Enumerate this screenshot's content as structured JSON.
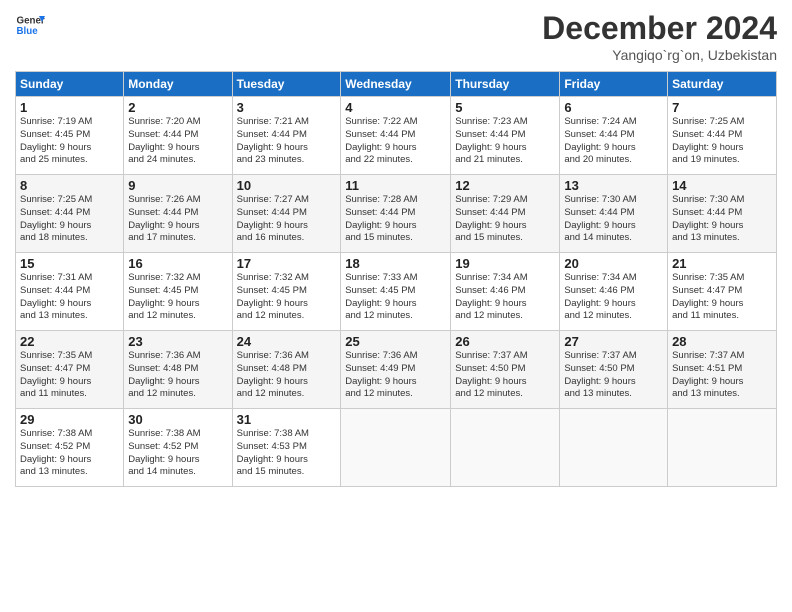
{
  "header": {
    "logo_line1": "General",
    "logo_line2": "Blue",
    "title": "December 2024",
    "subtitle": "Yangiqo`rg`on, Uzbekistan"
  },
  "weekdays": [
    "Sunday",
    "Monday",
    "Tuesday",
    "Wednesday",
    "Thursday",
    "Friday",
    "Saturday"
  ],
  "weeks": [
    [
      {
        "day": "1",
        "info": "Sunrise: 7:19 AM\nSunset: 4:45 PM\nDaylight: 9 hours\nand 25 minutes."
      },
      {
        "day": "2",
        "info": "Sunrise: 7:20 AM\nSunset: 4:44 PM\nDaylight: 9 hours\nand 24 minutes."
      },
      {
        "day": "3",
        "info": "Sunrise: 7:21 AM\nSunset: 4:44 PM\nDaylight: 9 hours\nand 23 minutes."
      },
      {
        "day": "4",
        "info": "Sunrise: 7:22 AM\nSunset: 4:44 PM\nDaylight: 9 hours\nand 22 minutes."
      },
      {
        "day": "5",
        "info": "Sunrise: 7:23 AM\nSunset: 4:44 PM\nDaylight: 9 hours\nand 21 minutes."
      },
      {
        "day": "6",
        "info": "Sunrise: 7:24 AM\nSunset: 4:44 PM\nDaylight: 9 hours\nand 20 minutes."
      },
      {
        "day": "7",
        "info": "Sunrise: 7:25 AM\nSunset: 4:44 PM\nDaylight: 9 hours\nand 19 minutes."
      }
    ],
    [
      {
        "day": "8",
        "info": "Sunrise: 7:25 AM\nSunset: 4:44 PM\nDaylight: 9 hours\nand 18 minutes."
      },
      {
        "day": "9",
        "info": "Sunrise: 7:26 AM\nSunset: 4:44 PM\nDaylight: 9 hours\nand 17 minutes."
      },
      {
        "day": "10",
        "info": "Sunrise: 7:27 AM\nSunset: 4:44 PM\nDaylight: 9 hours\nand 16 minutes."
      },
      {
        "day": "11",
        "info": "Sunrise: 7:28 AM\nSunset: 4:44 PM\nDaylight: 9 hours\nand 15 minutes."
      },
      {
        "day": "12",
        "info": "Sunrise: 7:29 AM\nSunset: 4:44 PM\nDaylight: 9 hours\nand 15 minutes."
      },
      {
        "day": "13",
        "info": "Sunrise: 7:30 AM\nSunset: 4:44 PM\nDaylight: 9 hours\nand 14 minutes."
      },
      {
        "day": "14",
        "info": "Sunrise: 7:30 AM\nSunset: 4:44 PM\nDaylight: 9 hours\nand 13 minutes."
      }
    ],
    [
      {
        "day": "15",
        "info": "Sunrise: 7:31 AM\nSunset: 4:44 PM\nDaylight: 9 hours\nand 13 minutes."
      },
      {
        "day": "16",
        "info": "Sunrise: 7:32 AM\nSunset: 4:45 PM\nDaylight: 9 hours\nand 12 minutes."
      },
      {
        "day": "17",
        "info": "Sunrise: 7:32 AM\nSunset: 4:45 PM\nDaylight: 9 hours\nand 12 minutes."
      },
      {
        "day": "18",
        "info": "Sunrise: 7:33 AM\nSunset: 4:45 PM\nDaylight: 9 hours\nand 12 minutes."
      },
      {
        "day": "19",
        "info": "Sunrise: 7:34 AM\nSunset: 4:46 PM\nDaylight: 9 hours\nand 12 minutes."
      },
      {
        "day": "20",
        "info": "Sunrise: 7:34 AM\nSunset: 4:46 PM\nDaylight: 9 hours\nand 12 minutes."
      },
      {
        "day": "21",
        "info": "Sunrise: 7:35 AM\nSunset: 4:47 PM\nDaylight: 9 hours\nand 11 minutes."
      }
    ],
    [
      {
        "day": "22",
        "info": "Sunrise: 7:35 AM\nSunset: 4:47 PM\nDaylight: 9 hours\nand 11 minutes."
      },
      {
        "day": "23",
        "info": "Sunrise: 7:36 AM\nSunset: 4:48 PM\nDaylight: 9 hours\nand 12 minutes."
      },
      {
        "day": "24",
        "info": "Sunrise: 7:36 AM\nSunset: 4:48 PM\nDaylight: 9 hours\nand 12 minutes."
      },
      {
        "day": "25",
        "info": "Sunrise: 7:36 AM\nSunset: 4:49 PM\nDaylight: 9 hours\nand 12 minutes."
      },
      {
        "day": "26",
        "info": "Sunrise: 7:37 AM\nSunset: 4:50 PM\nDaylight: 9 hours\nand 12 minutes."
      },
      {
        "day": "27",
        "info": "Sunrise: 7:37 AM\nSunset: 4:50 PM\nDaylight: 9 hours\nand 13 minutes."
      },
      {
        "day": "28",
        "info": "Sunrise: 7:37 AM\nSunset: 4:51 PM\nDaylight: 9 hours\nand 13 minutes."
      }
    ],
    [
      {
        "day": "29",
        "info": "Sunrise: 7:38 AM\nSunset: 4:52 PM\nDaylight: 9 hours\nand 13 minutes."
      },
      {
        "day": "30",
        "info": "Sunrise: 7:38 AM\nSunset: 4:52 PM\nDaylight: 9 hours\nand 14 minutes."
      },
      {
        "day": "31",
        "info": "Sunrise: 7:38 AM\nSunset: 4:53 PM\nDaylight: 9 hours\nand 15 minutes."
      },
      {
        "day": "",
        "info": ""
      },
      {
        "day": "",
        "info": ""
      },
      {
        "day": "",
        "info": ""
      },
      {
        "day": "",
        "info": ""
      }
    ]
  ]
}
